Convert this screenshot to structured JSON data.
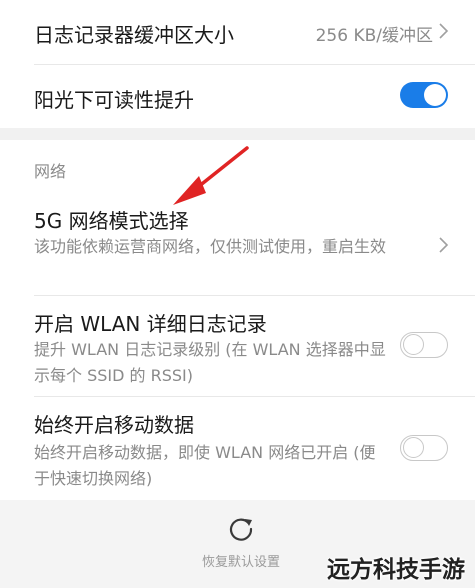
{
  "settings": {
    "log_buffer": {
      "title": "日志记录器缓冲区大小",
      "value": "256 KB/缓冲区"
    },
    "sunlight": {
      "title": "阳光下可读性提升",
      "enabled": true
    }
  },
  "network_section": {
    "title": "网络",
    "items": [
      {
        "title": "5G 网络模式选择",
        "description": "该功能依赖运营商网络，仅供测试使用，重启生效"
      },
      {
        "title": "开启 WLAN 详细日志记录",
        "description": "提升 WLAN 日志记录级别 (在 WLAN 选择器中显示每个 SSID 的 RSSI)",
        "enabled": false
      },
      {
        "title": "始终开启移动数据",
        "description": "始终开启移动数据，即使 WLAN 网络已开启 (便于快速切换网络)",
        "enabled": false
      }
    ]
  },
  "footer": {
    "reset_label": "恢复默认设置"
  },
  "watermark": "远方科技手游",
  "colors": {
    "accent": "#1a7de8",
    "arrow": "#e02424",
    "secondary_text": "#8a8a8a"
  }
}
